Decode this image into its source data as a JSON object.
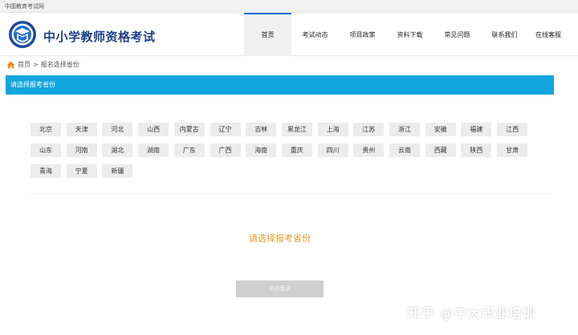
{
  "topbar": {
    "site_name": "中国教育考试网"
  },
  "header": {
    "title": "中小学教师资格考试",
    "nav": [
      "首页",
      "考试动态",
      "项目政策",
      "资料下载",
      "常见问题",
      "联系我们",
      "在线客服"
    ],
    "active_nav": "首页"
  },
  "breadcrumb": {
    "home": "首页",
    "separator": ">",
    "current": "报名选择省份"
  },
  "section": {
    "title": "请选择报考省份"
  },
  "provinces": [
    "北京",
    "天津",
    "河北",
    "山西",
    "内蒙古",
    "辽宁",
    "吉林",
    "黑龙江",
    "上海",
    "江苏",
    "浙江",
    "安徽",
    "福建",
    "江西",
    "山东",
    "河南",
    "湖北",
    "湖南",
    "广东",
    "广西",
    "海南",
    "重庆",
    "四川",
    "贵州",
    "云南",
    "西藏",
    "陕西",
    "甘肃",
    "青海",
    "宁夏",
    "新疆"
  ],
  "prompt": "请选择报考省份",
  "login_button": "点击登录",
  "watermark": "知乎 @中大职业培训",
  "colors": {
    "accent_bar": "#12a6df",
    "title_blue": "#1f3f8c",
    "prompt_orange": "#e39a2b"
  }
}
